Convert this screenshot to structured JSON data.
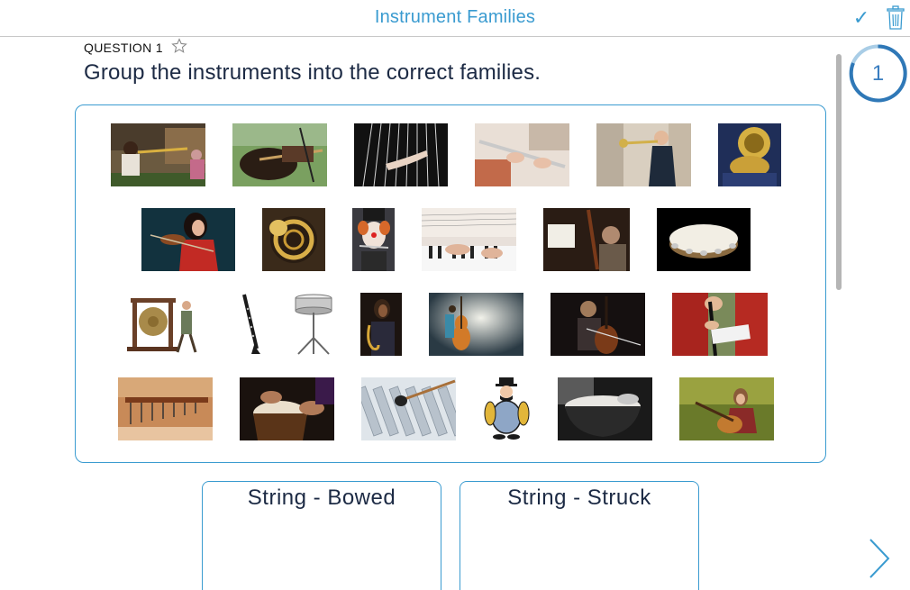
{
  "header": {
    "title": "Instrument Families"
  },
  "toolbar": {
    "check_icon": "check-icon",
    "trash_icon": "trash-icon"
  },
  "question": {
    "number_label": "QUESTION 1",
    "text": "Group the instruments into the correct families."
  },
  "progress": {
    "value": "1"
  },
  "categories": [
    {
      "label": "String - Bowed"
    },
    {
      "label": "String - Struck"
    }
  ],
  "instruments": [
    "trombone-street-players-photo",
    "acoustic-guitar-strumming-photo",
    "harp-photo",
    "flute-photo",
    "trumpet-player-photo",
    "tuba-photo",
    "violin-woman-photo",
    "french-horn-photo",
    "clown-flute-photo",
    "piano-keys-photo",
    "bassoon-orchestra-photo",
    "tambourine-photo",
    "gong-clipart",
    "clarinet-clipart",
    "snare-drum-clipart",
    "saxophone-photo",
    "double-bass-illustration",
    "cello-photo",
    "clarinet-player-photo",
    "marimba-photo",
    "hand-drum-photo",
    "xylophone-mallet-photo",
    "cymbals-character-clipart",
    "timpani-photo",
    "guitar-girl-field-photo"
  ],
  "colors": {
    "accent": "#3a9bd0",
    "text": "#1c2a44",
    "border": "#3a9bd0"
  }
}
